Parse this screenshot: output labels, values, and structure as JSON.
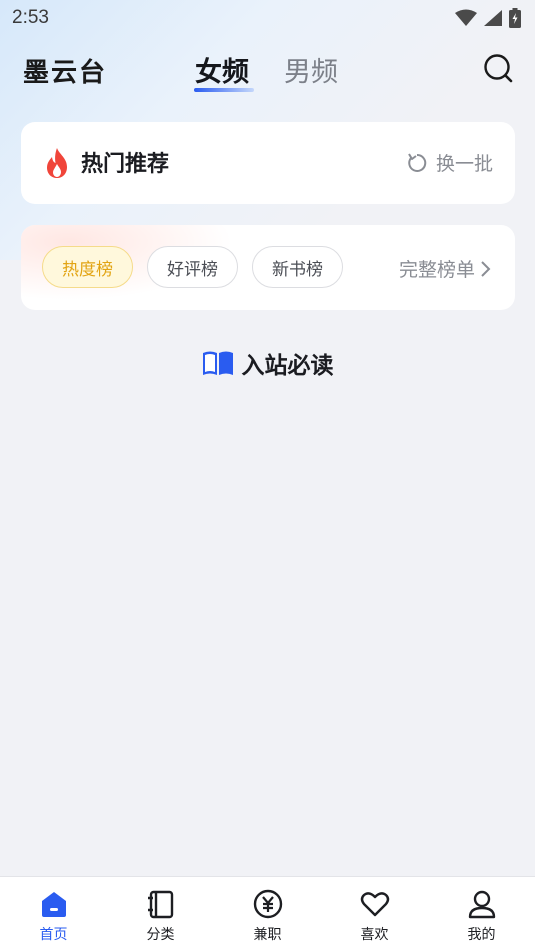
{
  "status_bar": {
    "time": "2:53"
  },
  "header": {
    "app_title": "墨云台",
    "tabs": [
      {
        "label": "女频",
        "active": true
      },
      {
        "label": "男频",
        "active": false
      }
    ]
  },
  "hot_section": {
    "title": "热门推荐",
    "refresh_label": "换一批"
  },
  "ranking": {
    "chips": [
      {
        "label": "热度榜",
        "active": true
      },
      {
        "label": "好评榜",
        "active": false
      },
      {
        "label": "新书榜",
        "active": false
      }
    ],
    "more_label": "完整榜单"
  },
  "must_read": {
    "title": "入站必读"
  },
  "bottom_nav": {
    "items": [
      {
        "label": "首页",
        "icon": "home-icon",
        "active": true
      },
      {
        "label": "分类",
        "icon": "category-icon",
        "active": false
      },
      {
        "label": "兼职",
        "icon": "yen-icon",
        "active": false
      },
      {
        "label": "喜欢",
        "icon": "heart-icon",
        "active": false
      },
      {
        "label": "我的",
        "icon": "user-icon",
        "active": false
      }
    ]
  },
  "colors": {
    "accent": "#2a5cf0",
    "fire": "#f0453a",
    "active_chip_text": "#e2a413",
    "active_chip_bg": "#fff8dc"
  }
}
